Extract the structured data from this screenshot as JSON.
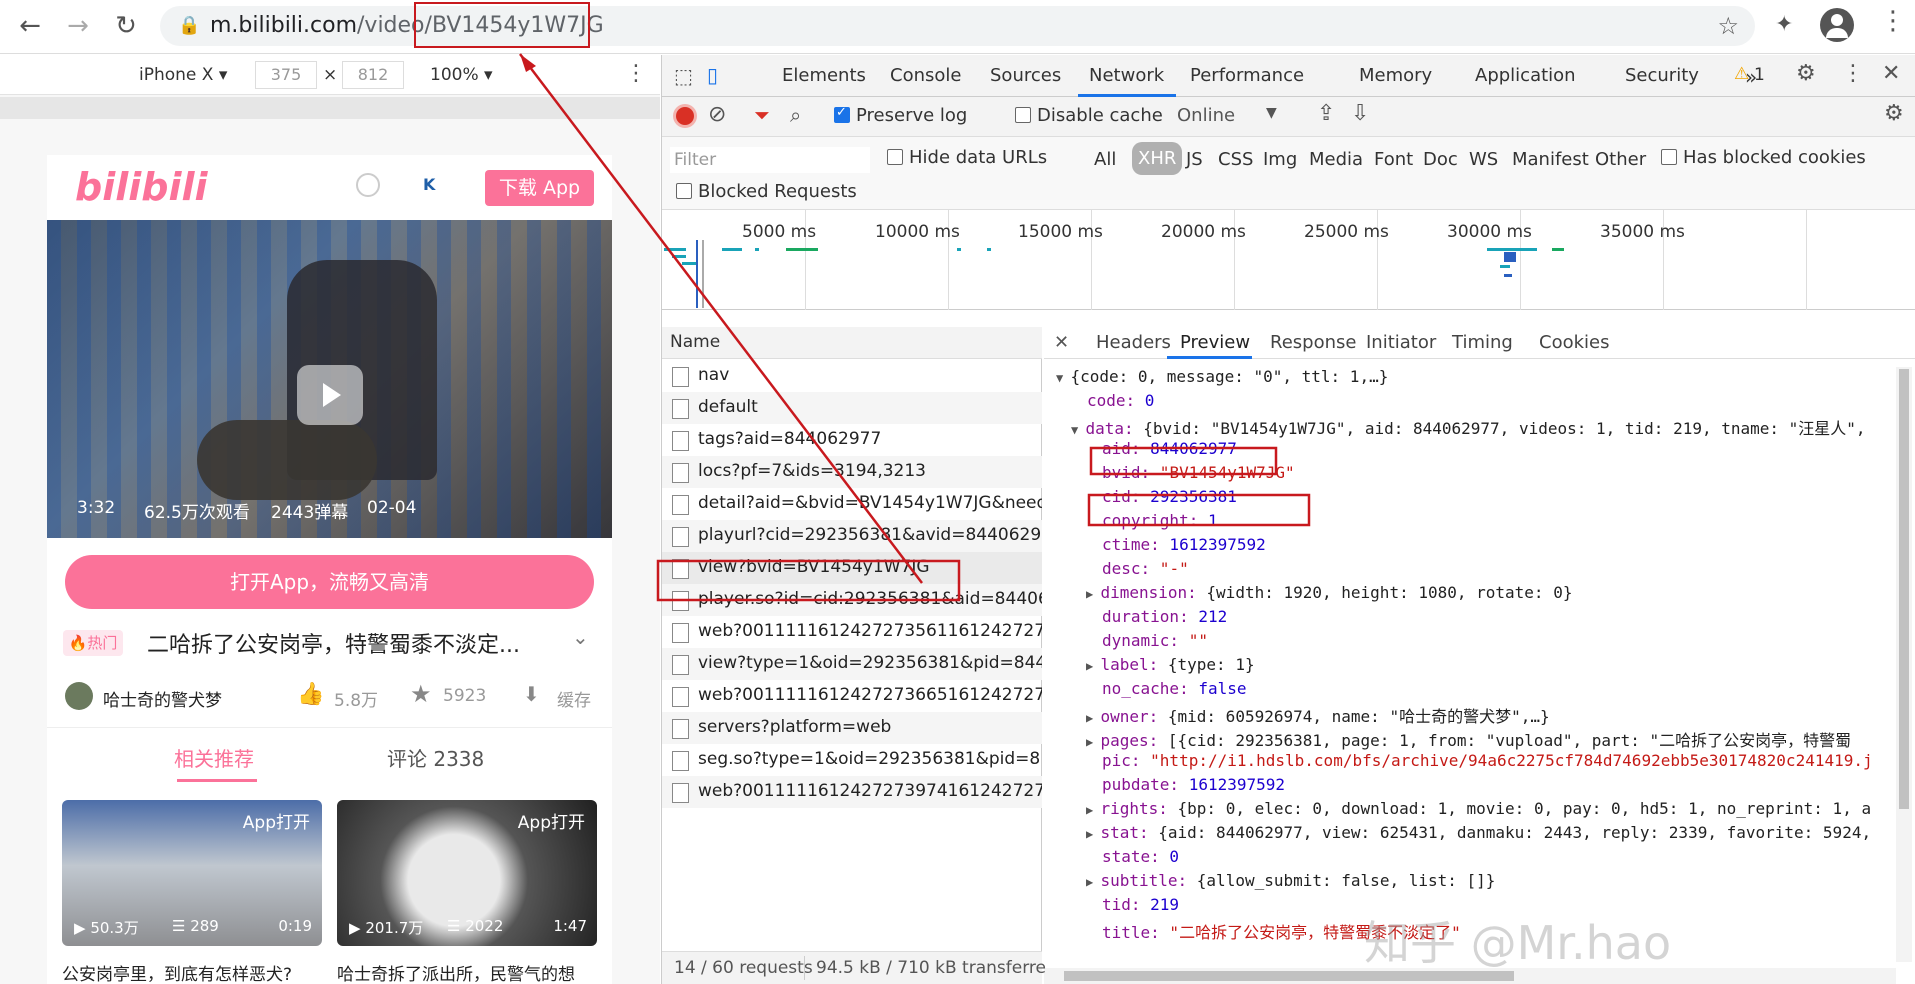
{
  "browser": {
    "url_host": "m.bilibili.com",
    "url_path": "/video/",
    "url_id": "BV1454y1W7JG"
  },
  "device_bar": {
    "device": "iPhone X",
    "width": "375",
    "height": "812",
    "zoom": "100%"
  },
  "phone": {
    "logo": "bilibili",
    "download_button": "下载 App",
    "video_duration": "3:32",
    "video_views": "62.5万次观看",
    "video_danmaku": "2443弹幕",
    "video_date": "02-04",
    "open_app_button": "打开App，流畅又高清",
    "hot_badge": "热门",
    "video_title": "二哈拆了公安岗亭，特警蜀黍不淡定...",
    "uploader": "哈士奇的警犬梦",
    "likes": "5.8万",
    "favorites": "5923",
    "cache_label": "缓存",
    "tab_related": "相关推荐",
    "tab_comments": "评论 2338",
    "cards": [
      {
        "badge": "App打开",
        "views": "50.3万",
        "danmaku": "289",
        "duration": "0:19",
        "title": "公安岗亭里，到底有怎样恶犬?"
      },
      {
        "badge": "App打开",
        "views": "201.7万",
        "danmaku": "2022",
        "duration": "1:47",
        "title": "哈士奇拆了派出所，民警气的想"
      }
    ]
  },
  "devtools": {
    "tabs": [
      "Elements",
      "Console",
      "Sources",
      "Network",
      "Performance",
      "Memory",
      "Application",
      "Security"
    ],
    "active_tab": "Network",
    "more": "»",
    "warning_count": "1",
    "preserve_log": "Preserve log",
    "disable_cache": "Disable cache",
    "throttle": "Online",
    "filter_placeholder": "Filter",
    "hide_data_urls": "Hide data URLs",
    "filter_types": [
      "All",
      "XHR",
      "JS",
      "CSS",
      "Img",
      "Media",
      "Font",
      "Doc",
      "WS",
      "Manifest",
      "Other"
    ],
    "active_filter": "XHR",
    "has_blocked_cookies": "Has blocked cookies",
    "blocked_requests": "Blocked Requests",
    "timeline_labels": [
      "5000 ms",
      "10000 ms",
      "15000 ms",
      "20000 ms",
      "25000 ms",
      "30000 ms",
      "35000 ms"
    ],
    "name_header": "Name",
    "requests": [
      "nav",
      "default",
      "tags?aid=844062977",
      "locs?pf=7&ids=3194,3213",
      "detail?aid=&bvid=BV1454y1W7JG&need_h...",
      "playurl?cid=292356381&avid=84406297...",
      "view?bvid=BV1454y1W7JG",
      "player.so?id=cid:292356381&aid=84406...",
      "web?0011111612427273561161242727...",
      "view?type=1&oid=292356381&pid=844...",
      "web?0011111612427273665161242727...",
      "servers?platform=web",
      "seg.so?type=1&oid=292356381&pid=8...",
      "web?0011111612427273974161242727..."
    ],
    "status_requests": "14 / 60 requests",
    "status_transfer": "94.5 kB / 710 kB transferre",
    "preview_tabs": [
      "Headers",
      "Preview",
      "Response",
      "Initiator",
      "Timing",
      "Cookies"
    ],
    "active_preview_tab": "Preview",
    "json_lines": [
      "{code: 0, message: \"0\", ttl: 1,…}",
      "code: 0",
      "data: {bvid: \"BV1454y1W7JG\", aid: 844062977, videos: 1, tid: 219, tname: \"汪星人\",",
      "aid: 844062977",
      "bvid: \"BV1454y1W7JG\"",
      "cid: 292356381",
      "copyright: 1",
      "ctime: 1612397592",
      "desc: \"-\"",
      "dimension: {width: 1920, height: 1080, rotate: 0}",
      "duration: 212",
      "dynamic: \"\"",
      "label: {type: 1}",
      "no_cache: false",
      "owner: {mid: 605926974, name: \"哈士奇的警犬梦\",…}",
      "pages: [{cid: 292356381, page: 1, from: \"vupload\", part: \"二哈拆了公安岗亭，特警蜀",
      "pic: \"http://i1.hdslb.com/bfs/archive/94a6c2275cf784d74692ebb5e30174820c241419.j",
      "pubdate: 1612397592",
      "rights: {bp: 0, elec: 0, download: 1, movie: 0, pay: 0, hd5: 1, no_reprint: 1, a",
      "stat: {aid: 844062977, view: 625431, danmaku: 2443, reply: 2339, favorite: 5924,",
      "state: 0",
      "subtitle: {allow_submit: false, list: []}",
      "tid: 219",
      "title: \"二哈拆了公安岗亭，特警蜀黍不淡定了\""
    ],
    "watermark": "知乎 @Mr.hao"
  },
  "colors": {
    "accent_pink": "#fb7299",
    "red_annot": "#c8191e",
    "devtools_blue": "#1a73e8"
  }
}
